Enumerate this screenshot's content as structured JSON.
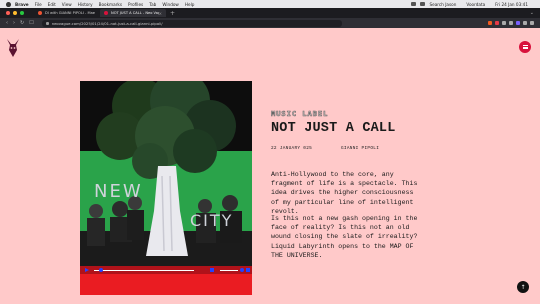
{
  "menubar": {
    "app_name": "Brave",
    "items": [
      "File",
      "Edit",
      "View",
      "History",
      "Bookmarks",
      "Profiles",
      "Tab",
      "Window",
      "Help"
    ],
    "status": [
      "Search Jason",
      "Voordata"
    ],
    "clock": "Fri 24 Jan 03:41"
  },
  "tabs": [
    {
      "title": "DI with GIANNI PIPOLI - Mae"
    },
    {
      "title": "NOT JUST A CALL - Neo Vague"
    }
  ],
  "toolbar": {
    "url": "neovague.com/2025/01/24/01-not-just-a-call-gianni-pipoli/"
  },
  "colors": {
    "page_bg": "#ffc9c9",
    "accent": "#d8123c",
    "player_red": "#ea1c22",
    "player_blue": "#2442ff"
  },
  "article": {
    "label": "MUSIC LABEL",
    "title": "NOT JUST A CALL",
    "date": "22 JANUARY 025",
    "author": "GIANNI PIPOLI",
    "paragraphs": [
      "Anti-Hollywood to the core, any fragment of life is a spectacle. This idea drives the higher consciousness of my particular line of intelligent revolt.",
      "Is this not a new gash opening in the face of reality? Is this not an old wound closing the slate of irreality? Liquid Labyrinth opens to the MAP OF THE UNIVERSE."
    ]
  },
  "cover": {
    "words": [
      "NEW",
      "CITY"
    ]
  },
  "icons": {
    "logo": "devil-head-icon",
    "menu": "hamburger-icon",
    "scroll": "arrow-up-icon",
    "play": "play-icon",
    "volume": "volume-icon"
  }
}
